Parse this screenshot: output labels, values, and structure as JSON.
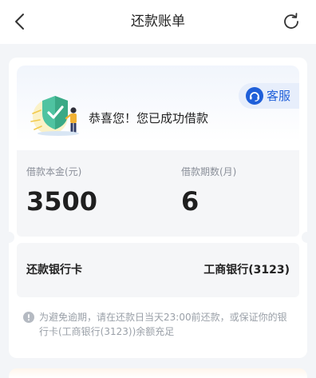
{
  "nav": {
    "title": "还款账单",
    "back_icon": "chevron-left-icon",
    "refresh_icon": "refresh-icon"
  },
  "hero": {
    "service_label": "客服",
    "service_icon": "headset-icon",
    "congrats": "恭喜您！您已成功借款",
    "illustration": "shield-check-person-icon"
  },
  "loan": {
    "principal_label": "借款本金(元)",
    "principal_value": "3500",
    "term_label": "借款期数(月)",
    "term_value": "6"
  },
  "bank": {
    "label": "还款银行卡",
    "value": "工商银行(3123)"
  },
  "notice": {
    "icon": "info-icon",
    "text": "为避免逾期，请在还款日当天23:00前还款，或保证你的银行卡(工商银行(3123))余额充足"
  },
  "colors": {
    "accent": "#1f5fd9",
    "service_bg": "#e7eefb",
    "panel_bg": "#f5f6f8",
    "page_bg": "#f3f5f8"
  }
}
